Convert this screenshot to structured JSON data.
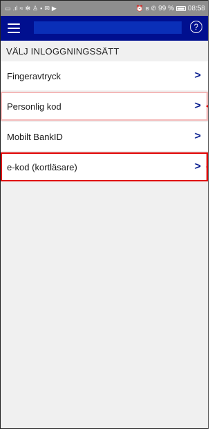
{
  "status_bar": {
    "left_icons": [
      "sim-icon",
      "signal-icon",
      "wifi-icon",
      "app-icon",
      "app-icon",
      "message-icon",
      "mail-icon",
      "play-icon"
    ],
    "right_text": "99 %",
    "time": "08:58",
    "battery_level": 0.99
  },
  "app_bar": {
    "menu_icon": "hamburger-icon",
    "help_icon": "question-icon",
    "help_glyph": "?",
    "color": "#000f8f"
  },
  "section_title": "VÄLJ INLOGGNINGSSÄTT",
  "options": [
    {
      "label": "Fingeravtryck",
      "chevron": ">"
    },
    {
      "label": "Personlig kod",
      "chevron": ">"
    },
    {
      "label": "Mobilt BankID",
      "chevron": ">"
    },
    {
      "label": "e-kod (kortläsare)",
      "chevron": ">"
    }
  ],
  "colors": {
    "accent": "#0a1f8f",
    "highlight_strong": "#e00000",
    "highlight_soft": "#f4b9b9"
  }
}
